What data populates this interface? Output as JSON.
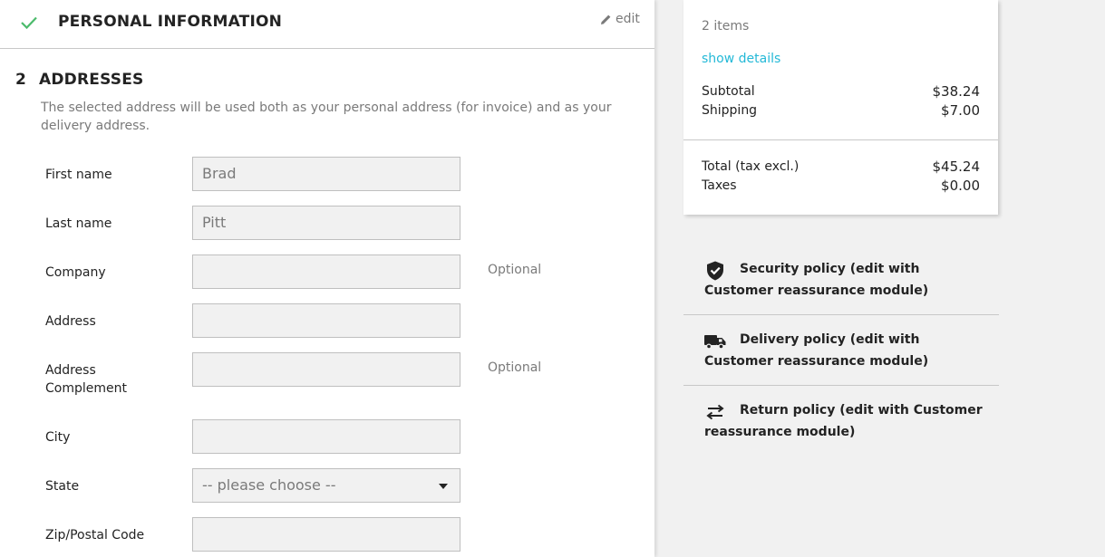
{
  "personal": {
    "title": "PERSONAL INFORMATION",
    "edit_label": "edit"
  },
  "addresses": {
    "step_number": "2",
    "title": "ADDRESSES",
    "help": "The selected address will be used both as your personal address (for invoice) and as your delivery address."
  },
  "form": {
    "optional_label": "Optional",
    "fields": [
      {
        "label": "First name",
        "value": "Brad"
      },
      {
        "label": "Last name",
        "value": "Pitt"
      },
      {
        "label": "Company",
        "value": ""
      },
      {
        "label": "Address",
        "value": ""
      },
      {
        "label": "Address Complement",
        "value": ""
      },
      {
        "label": "City",
        "value": ""
      },
      {
        "label": "State",
        "value": "-- please choose --"
      },
      {
        "label": "Zip/Postal Code",
        "value": ""
      }
    ]
  },
  "summary": {
    "items_count": "2 items",
    "show_details": "show details",
    "subtotal_label": "Subtotal",
    "subtotal_value": "$38.24",
    "shipping_label": "Shipping",
    "shipping_value": "$7.00",
    "total_label": "Total (tax excl.)",
    "total_value": "$45.24",
    "taxes_label": "Taxes",
    "taxes_value": "$0.00"
  },
  "reassurance": [
    {
      "text": "Security policy (edit with Customer reassurance module)",
      "icon": "shield-check-icon"
    },
    {
      "text": "Delivery policy (edit with Customer reassurance module)",
      "icon": "truck-icon"
    },
    {
      "text": "Return policy (edit with Customer reassurance module)",
      "icon": "swap-arrows-icon"
    }
  ],
  "colors": {
    "accent": "#24b9d7",
    "check": "#4cbb6c"
  }
}
